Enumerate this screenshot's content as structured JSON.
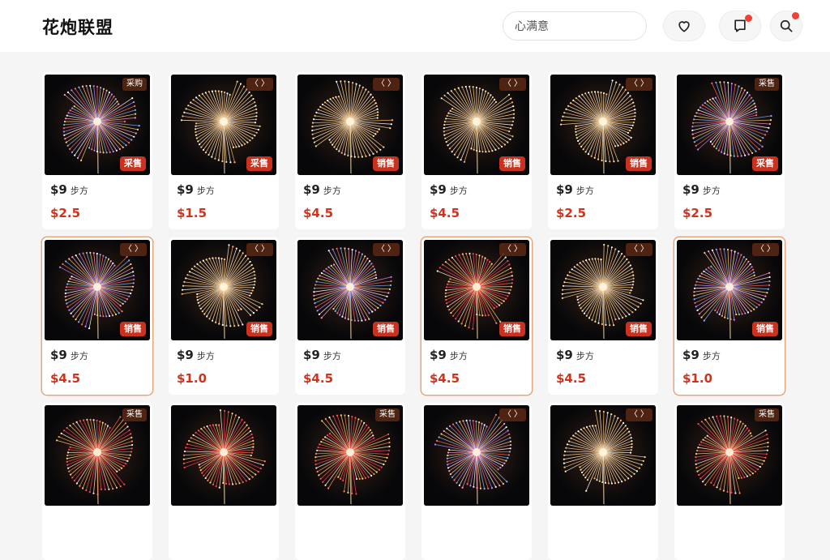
{
  "header": {
    "logo": "花炮联盟",
    "search_value": "心满意",
    "icons": [
      "heart-icon",
      "message-icon",
      "search-icon"
    ]
  },
  "colors": {
    "price": "#d0321c",
    "sale_badge": "#c8321f",
    "notification_dot": "#ef4136"
  },
  "products": [
    {
      "tag": "采购",
      "sale": "采售",
      "base": "$9",
      "unit": "步方",
      "price": "$2.5",
      "hue": "mix",
      "selected": false
    },
    {
      "tag": "〈 〉",
      "sale": "采售",
      "base": "$9",
      "unit": "步方",
      "price": "$1.5",
      "hue": "gold",
      "selected": false
    },
    {
      "tag": "〈 〉",
      "sale": "销售",
      "base": "$9",
      "unit": "步方",
      "price": "$4.5",
      "hue": "gold",
      "selected": false
    },
    {
      "tag": "〈 〉",
      "sale": "销售",
      "base": "$9",
      "unit": "步方",
      "price": "$4.5",
      "hue": "gold",
      "selected": false
    },
    {
      "tag": "〈 〉",
      "sale": "销售",
      "base": "$9",
      "unit": "步方",
      "price": "$2.5",
      "hue": "gold",
      "selected": false
    },
    {
      "tag": "采售",
      "sale": "采售",
      "base": "$9",
      "unit": "步方",
      "price": "$2.5",
      "hue": "mix",
      "selected": false
    },
    {
      "tag": "〈 〉",
      "sale": "销售",
      "base": "$9",
      "unit": "步方",
      "price": "$4.5",
      "hue": "mix",
      "selected": true
    },
    {
      "tag": "〈 〉",
      "sale": "销售",
      "base": "$9",
      "unit": "步方",
      "price": "$1.0",
      "hue": "gold",
      "selected": false
    },
    {
      "tag": "〈 〉",
      "sale": "销售",
      "base": "$9",
      "unit": "步方",
      "price": "$4.5",
      "hue": "mix",
      "selected": false
    },
    {
      "tag": "〈 〉",
      "sale": "销售",
      "base": "$9",
      "unit": "步方",
      "price": "$4.5",
      "hue": "red",
      "selected": true
    },
    {
      "tag": "〈 〉",
      "sale": "销售",
      "base": "$9",
      "unit": "步方",
      "price": "$4.5",
      "hue": "gold",
      "selected": false
    },
    {
      "tag": "〈 〉",
      "sale": "销售",
      "base": "$9",
      "unit": "步方",
      "price": "$1.0",
      "hue": "mix",
      "selected": true
    },
    {
      "tag": "采售",
      "sale": "",
      "base": "",
      "unit": "",
      "price": "",
      "hue": "red",
      "selected": false
    },
    {
      "tag": "",
      "sale": "",
      "base": "",
      "unit": "",
      "price": "",
      "hue": "red",
      "selected": false
    },
    {
      "tag": "采售",
      "sale": "",
      "base": "",
      "unit": "",
      "price": "",
      "hue": "red",
      "selected": false
    },
    {
      "tag": "〈 〉",
      "sale": "",
      "base": "",
      "unit": "",
      "price": "",
      "hue": "mix",
      "selected": false
    },
    {
      "tag": "〈 〉",
      "sale": "",
      "base": "",
      "unit": "",
      "price": "",
      "hue": "gold",
      "selected": false
    },
    {
      "tag": "采售",
      "sale": "",
      "base": "",
      "unit": "",
      "price": "",
      "hue": "red",
      "selected": false
    }
  ]
}
